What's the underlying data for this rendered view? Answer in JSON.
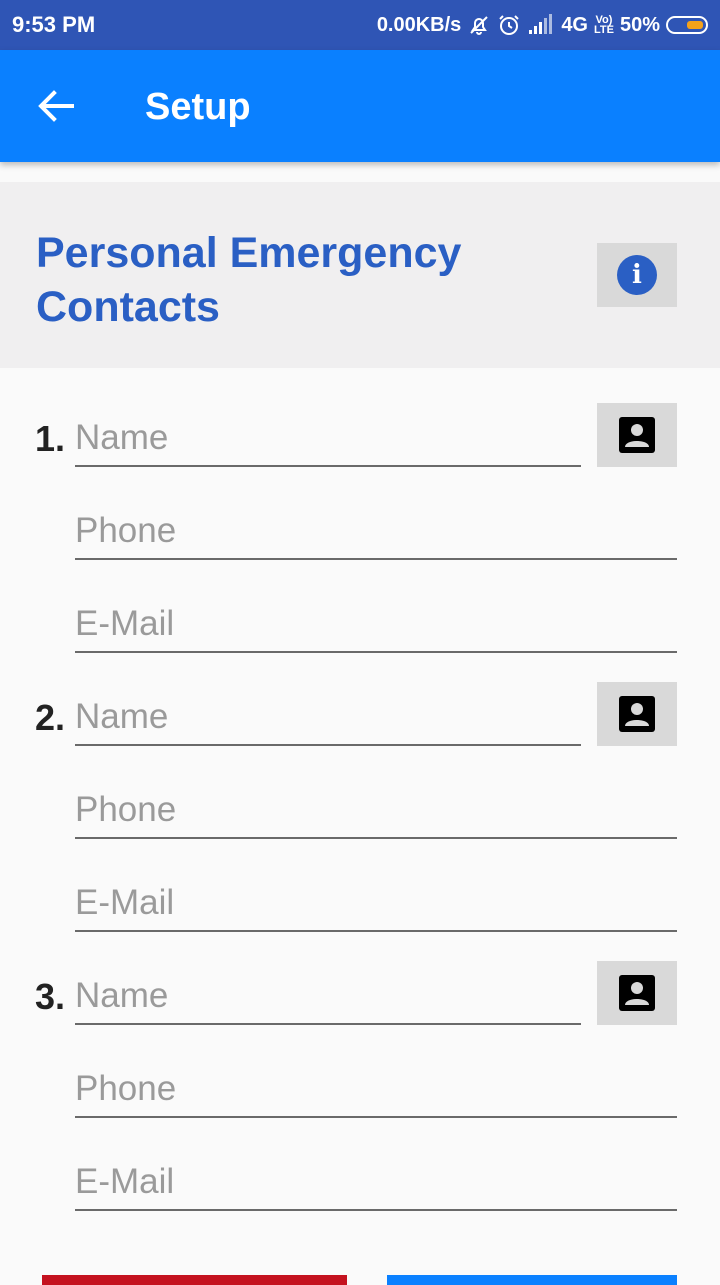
{
  "status_bar": {
    "time": "9:53 PM",
    "net_speed": "0.00KB/s",
    "network": "4G",
    "volte_top": "Vo)",
    "volte_bottom": "LTE",
    "battery": "50%",
    "battery_level": 0.5,
    "battery_color": "#f4a21b"
  },
  "app_bar": {
    "title": "Setup",
    "back_icon": "arrow-left-icon",
    "color": "#0a80ff"
  },
  "section": {
    "heading": "Personal Emergency Contacts",
    "info_icon": "info-icon"
  },
  "contacts": [
    {
      "number": "1.",
      "name_placeholder": "Name",
      "phone_placeholder": "Phone",
      "email_placeholder": "E-Mail"
    },
    {
      "number": "2.",
      "name_placeholder": "Name",
      "phone_placeholder": "Phone",
      "email_placeholder": "E-Mail"
    },
    {
      "number": "3.",
      "name_placeholder": "Name",
      "phone_placeholder": "Phone",
      "email_placeholder": "E-Mail"
    }
  ],
  "colors": {
    "accent": "#2a5fc4",
    "danger": "#c4121f",
    "primary": "#0a80ff"
  }
}
